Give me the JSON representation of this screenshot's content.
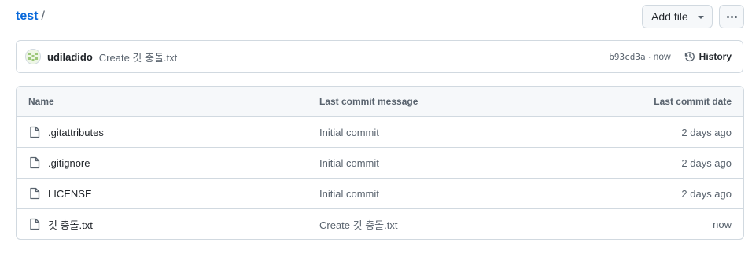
{
  "breadcrumb": {
    "repo": "test",
    "separator": "/"
  },
  "actions": {
    "add_file_label": "Add file"
  },
  "latest_commit": {
    "author": "udiladido",
    "message": "Create 깃 충돌.txt",
    "sha": "b93cd3a",
    "dot": "·",
    "time": "now",
    "history_label": "History"
  },
  "table": {
    "headers": {
      "name": "Name",
      "message": "Last commit message",
      "date": "Last commit date"
    },
    "rows": [
      {
        "name": ".gitattributes",
        "message": "Initial commit",
        "date": "2 days ago"
      },
      {
        "name": ".gitignore",
        "message": "Initial commit",
        "date": "2 days ago"
      },
      {
        "name": "LICENSE",
        "message": "Initial commit",
        "date": "2 days ago"
      },
      {
        "name": "깃 충돌.txt",
        "message": "Create 깃 충돌.txt",
        "date": "now"
      }
    ]
  },
  "colors": {
    "link": "#0969da",
    "border": "#d1d9e0",
    "muted": "#59636e",
    "header_bg": "#f6f8fa"
  },
  "icons": {
    "file": "file-icon",
    "history": "history-icon",
    "more": "kebab-horizontal-icon",
    "caret": "triangle-down-icon"
  }
}
